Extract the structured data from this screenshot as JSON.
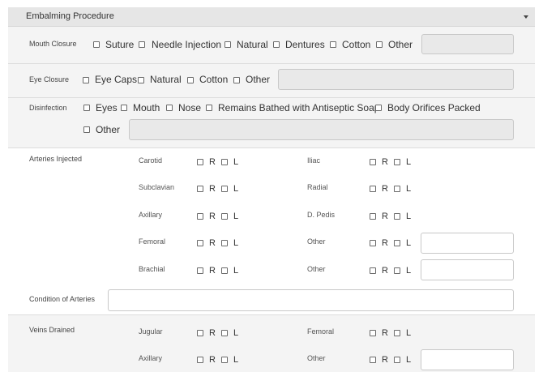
{
  "section": {
    "title": "Embalming Procedure"
  },
  "mouth_closure": {
    "label": "Mouth Closure",
    "options": [
      "Suture",
      "Needle Injection",
      "Natural",
      "Dentures",
      "Cotton",
      "Other"
    ],
    "other_value": ""
  },
  "eye_closure": {
    "label": "Eye Closure",
    "options": [
      "Eye Caps",
      "Natural",
      "Cotton",
      "Other"
    ],
    "other_value": ""
  },
  "disinfection": {
    "label": "Disinfection",
    "options": [
      "Eyes",
      "Mouth",
      "Nose",
      "Remains Bathed with Antiseptic Soap",
      "Body Orifices Packed",
      "Other"
    ],
    "other_value": ""
  },
  "side_labels": {
    "right": "R",
    "left": "L"
  },
  "arteries_injected": {
    "label": "Arteries Injected",
    "left_column": [
      "Carotid",
      "Subclavian",
      "Axillary",
      "Femoral",
      "Brachial"
    ],
    "right_column": [
      "Iliac",
      "Radial",
      "D. Pedis",
      "Other",
      "Other"
    ],
    "other_values": [
      "",
      ""
    ]
  },
  "condition_of_arteries": {
    "label": "Condition of Arteries",
    "value": ""
  },
  "veins_drained": {
    "label": "Veins Drained",
    "left_column": [
      "Jugular",
      "Axillary"
    ],
    "right_column": [
      "Femoral",
      "Other"
    ],
    "other_value": ""
  }
}
